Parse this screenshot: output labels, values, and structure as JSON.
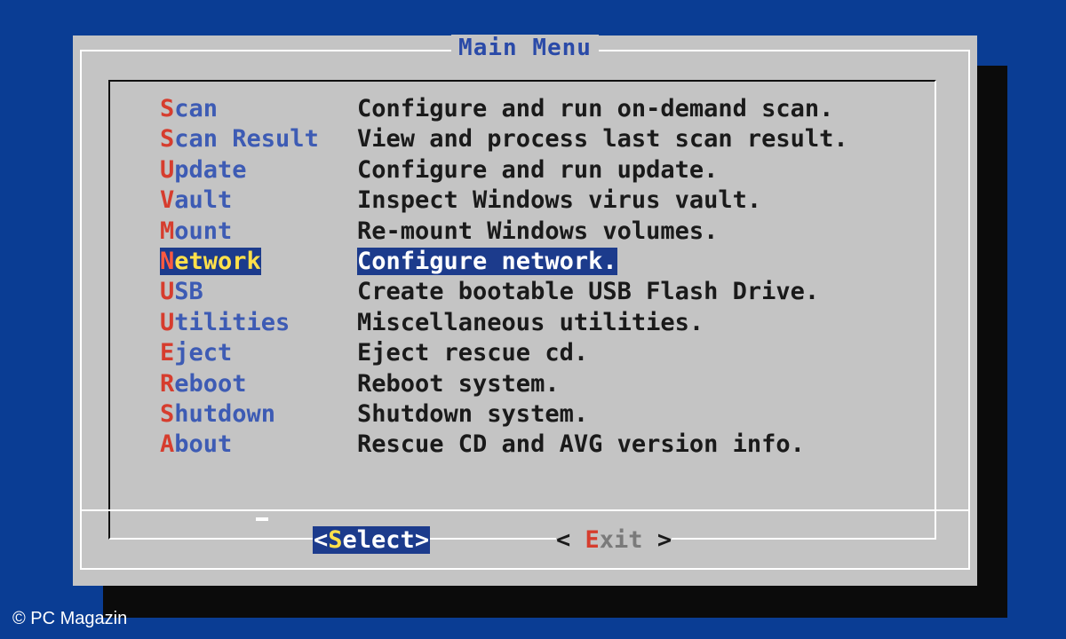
{
  "dialog": {
    "title": "Main Menu",
    "items": [
      {
        "hot": "S",
        "rest": "can",
        "desc": "Configure and run on-demand scan."
      },
      {
        "hot": "S",
        "rest": "can Result",
        "desc": "View and process last scan result."
      },
      {
        "hot": "U",
        "rest": "pdate",
        "desc": "Configure and run update."
      },
      {
        "hot": "V",
        "rest": "ault",
        "desc": "Inspect Windows virus vault."
      },
      {
        "hot": "M",
        "rest": "ount",
        "desc": "Re-mount Windows volumes."
      },
      {
        "hot": "N",
        "rest": "etwork",
        "desc": "Configure network."
      },
      {
        "hot": "U",
        "rest": "SB",
        "desc": "Create bootable USB Flash Drive."
      },
      {
        "hot": "U",
        "rest": "tilities",
        "desc": "Miscellaneous utilities."
      },
      {
        "hot": "E",
        "rest": "ject",
        "desc": "Eject rescue cd."
      },
      {
        "hot": "R",
        "rest": "eboot",
        "desc": "Reboot system."
      },
      {
        "hot": "S",
        "rest": "hutdown",
        "desc": "Shutdown system."
      },
      {
        "hot": "A",
        "rest": "bout",
        "desc": "Rescue CD and AVG version info."
      }
    ],
    "selected_index": 5,
    "buttons": {
      "select": {
        "open": "<",
        "hot": "S",
        "rest": "elect",
        "close": ">"
      },
      "exit": {
        "open": "< ",
        "hot": "E",
        "rest": "xit",
        "close": " >"
      }
    }
  },
  "copyright": "© PC Magazin",
  "colors": {
    "background": "#0a3d94",
    "dialog": "#c4c4c4",
    "highlight": "#1c3b8c",
    "hotkey": "#d63d2e",
    "item_text": "#3d5bb4"
  }
}
